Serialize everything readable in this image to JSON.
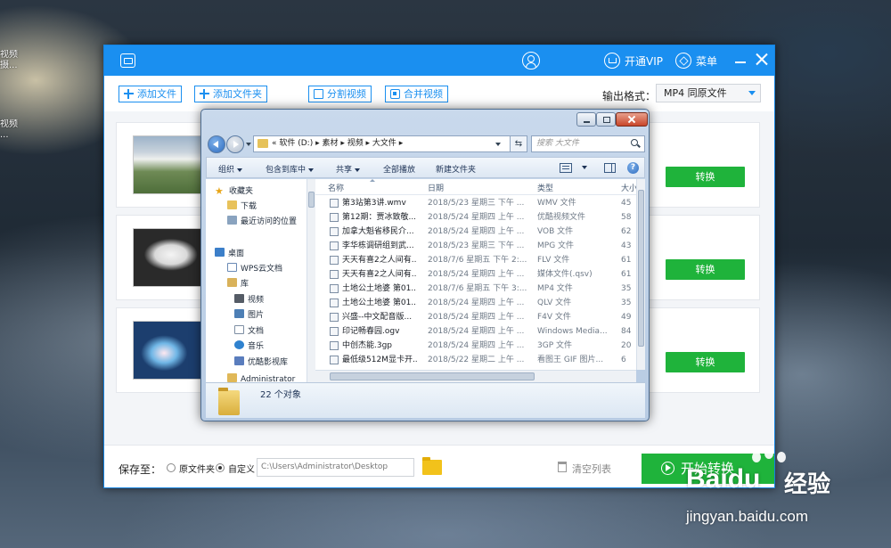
{
  "desktop": {
    "labels": [
      "视频\n摄...",
      "视频\n..."
    ]
  },
  "app": {
    "titlebar": {
      "vip_label": "开通VIP",
      "menu_label": "菜单"
    },
    "toolbar": {
      "add_file": "添加文件",
      "add_folder": "添加文件夹",
      "split_video": "分割视频",
      "merge_video": "合并视频",
      "output_format_label": "输出格式：",
      "output_format_value": "MP4  同原文件"
    },
    "items": [
      {
        "convert_label": "转换"
      },
      {
        "convert_label": "转换"
      },
      {
        "convert_label": "转换"
      }
    ],
    "footer": {
      "save_to_label": "保存至：",
      "option_original": "原文件夹",
      "option_custom": "自定义",
      "selected_option": "custom",
      "save_path": "C:\\Users\\Administrator\\Desktop",
      "clear_list": "清空列表",
      "start_convert": "开始转换"
    },
    "colors": {
      "brand_blue": "#1a8ff0",
      "convert_green": "#1fb33b"
    }
  },
  "dialog": {
    "breadcrumb": "«  软件 (D:)  ▸  素材  ▸  视频  ▸  大文件  ▸",
    "search_placeholder": "搜索 大文件",
    "commands": {
      "organize": "组织",
      "include_in_library": "包含到库中",
      "share": "共享",
      "play_all": "全部播放",
      "new_folder": "新建文件夹"
    },
    "nav": [
      {
        "label": "收藏夹",
        "icon": "star-icon"
      },
      {
        "label": "下载",
        "icon": "download-folder-icon"
      },
      {
        "label": "最近访问的位置",
        "icon": "recent-places-icon"
      },
      {
        "label": "桌面",
        "icon": "desktop-icon"
      },
      {
        "label": "WPS云文档",
        "icon": "wps-cloud-icon"
      },
      {
        "label": "库",
        "icon": "library-icon"
      },
      {
        "label": "视频",
        "icon": "video-library-icon"
      },
      {
        "label": "图片",
        "icon": "picture-library-icon"
      },
      {
        "label": "文档",
        "icon": "document-library-icon"
      },
      {
        "label": "音乐",
        "icon": "music-library-icon"
      },
      {
        "label": "优酷影视库",
        "icon": "youku-library-icon"
      },
      {
        "label": "Administrator",
        "icon": "user-folder-icon"
      }
    ],
    "columns": {
      "name": "名称",
      "date": "日期",
      "type": "类型",
      "size": "大小"
    },
    "files": [
      {
        "name": "第3站第3讲.wmv",
        "date": "2018/5/23 星期三 下午 ...",
        "type": "WMV 文件",
        "size": "45"
      },
      {
        "name": "第12期：贾冰致敬...",
        "date": "2018/5/24 星期四 上午 ...",
        "type": "优酷视频文件",
        "size": "58"
      },
      {
        "name": "加拿大魁省移民介...",
        "date": "2018/5/24 星期四 上午 ...",
        "type": "VOB 文件",
        "size": "62"
      },
      {
        "name": "李华栋调研组到武...",
        "date": "2018/5/23 星期三 下午 ...",
        "type": "MPG 文件",
        "size": "43"
      },
      {
        "name": "天天有喜2之人间有...",
        "date": "2018/7/6 星期五 下午 2:...",
        "type": "FLV 文件",
        "size": "61"
      },
      {
        "name": "天天有喜2之人间有...",
        "date": "2018/5/24 星期四 上午 ...",
        "type": "媒体文件(.qsv)",
        "size": "61"
      },
      {
        "name": "土地公土地婆 第01...",
        "date": "2018/7/6 星期五 下午 3:...",
        "type": "MP4 文件",
        "size": "35"
      },
      {
        "name": "土地公土地婆 第01...",
        "date": "2018/5/24 星期四 上午 ...",
        "type": "QLV 文件",
        "size": "35"
      },
      {
        "name": "兴盛--中文配音版...",
        "date": "2018/5/24 星期四 上午 ...",
        "type": "F4V 文件",
        "size": "49"
      },
      {
        "name": "印记畅春园.ogv",
        "date": "2018/5/24 星期四 上午 ...",
        "type": "Windows Media...",
        "size": "84"
      },
      {
        "name": "中创杰能.3gp",
        "date": "2018/5/24 星期四 上午 ...",
        "type": "3GP 文件",
        "size": "20"
      },
      {
        "name": "最低级512M显卡开...",
        "date": "2018/5/22 星期二 上午 ...",
        "type": "看图王 GIF 图片...",
        "size": "6"
      }
    ],
    "object_count": "22 个对象"
  },
  "watermark": {
    "brand": "Bai",
    "brand_suffix": "du",
    "cn": "经验",
    "url": "jingyan.baidu.com"
  }
}
